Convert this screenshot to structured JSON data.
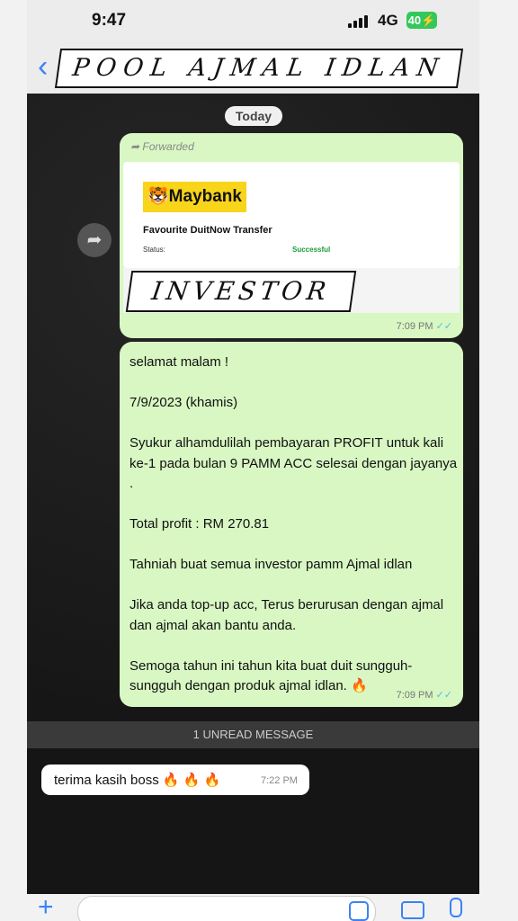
{
  "status_bar": {
    "time": "9:47",
    "network": "4G",
    "battery": "40"
  },
  "header": {
    "back_icon": "chevron-left-icon",
    "title": "POOL AJMAL IDLAN"
  },
  "date_chip": "Today",
  "messages": [
    {
      "direction": "outgoing",
      "forwarded_label": "Forwarded",
      "image": {
        "bank_logo": "Maybank",
        "title": "Favourite DuitNow Transfer",
        "status_label": "Status:",
        "status_value": "Successful",
        "overlay_label": "INVESTOR"
      },
      "time": "7:09 PM"
    },
    {
      "direction": "outgoing",
      "text": "selamat malam !\n\n7/9/2023 (khamis)\n\nSyukur alhamdulilah pembayaran PROFIT untuk kali ke-1 pada bulan 9 PAMM ACC selesai dengan jayanya .\n\nTotal profit : RM 270.81\n\nTahniah buat semua investor pamm Ajmal idlan\n\nJika anda top-up acc, Terus berurusan dengan ajmal dan ajmal akan bantu anda.\n\nSemoga tahun ini tahun kita buat duit sungguh-sungguh dengan produk ajmal idlan. 🔥",
      "time": "7:09 PM"
    },
    {
      "direction": "incoming",
      "text": "terima kasih boss 🔥 🔥 🔥",
      "time": "7:22 PM"
    }
  ],
  "unread_banner": "1 UNREAD MESSAGE",
  "colors": {
    "outgoing_bubble": "#d8f7c3",
    "accent": "#3b82f6",
    "read_ticks": "#53bdeb"
  }
}
